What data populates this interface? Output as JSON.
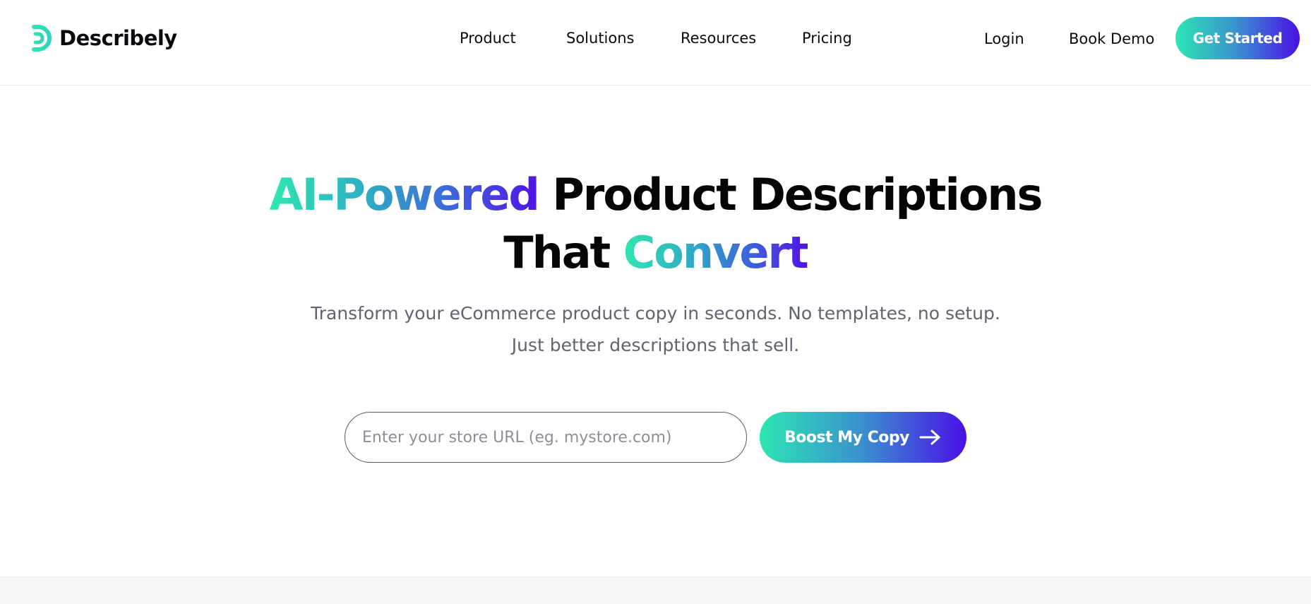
{
  "brand": {
    "name": "Describely",
    "logo_icon": "speed-lines-d-logo",
    "accent_start": "#2de6b3",
    "accent_end": "#4a10e6"
  },
  "nav": {
    "product": "Product",
    "solutions": "Solutions",
    "resources": "Resources",
    "pricing": "Pricing",
    "login": "Login",
    "book_demo": "Book Demo",
    "get_started": "Get Started"
  },
  "hero": {
    "headline_highlight_1": "AI-Powered",
    "headline_rest_1": " Product Descriptions",
    "headline_plain_2": "That ",
    "headline_highlight_2": "Convert",
    "subline_1": "Transform your eCommerce product copy in seconds. No templates, no setup.",
    "subline_2": "Just better descriptions that sell.",
    "url_placeholder": "Enter your store URL (eg. mystore.com)",
    "url_value": "",
    "cta_label": "Boost My Copy",
    "cta_icon": "arrow-right-icon"
  }
}
